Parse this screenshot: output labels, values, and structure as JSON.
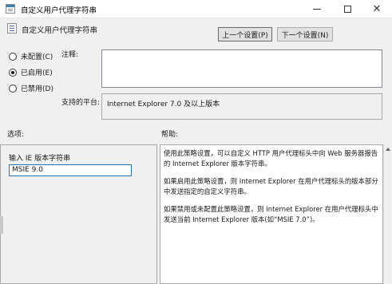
{
  "window": {
    "title": "自定义用户代理字符串",
    "minimize_label": "—",
    "maximize_label": "□",
    "close_label": "✕"
  },
  "header": {
    "setting_name": "自定义用户代理字符串",
    "prev_button": "上一个设置(P)",
    "next_button": "下一个设置(N)"
  },
  "state": {
    "options": [
      {
        "label": "未配置(C)",
        "checked": false
      },
      {
        "label": "已启用(E)",
        "checked": true
      },
      {
        "label": "已禁用(D)",
        "checked": false
      }
    ]
  },
  "comment": {
    "label": "注释:",
    "value": ""
  },
  "support": {
    "label": "支持的平台:",
    "value": "Internet Explorer 7.0 及以上版本"
  },
  "options_section": {
    "heading": "选项:",
    "field_label": "输入 IE 版本字符串",
    "field_value": "MSIE 9.0"
  },
  "help_section": {
    "heading": "帮助:",
    "paragraphs": [
      "使用此策略设置，可以自定义 HTTP 用户代理标头中向 Web 服务器报告的 Internet Explorer 版本字符串。",
      "如果启用此策略设置，则 Internet Explorer 在用户代理标头的版本部分中发送指定的自定义字符串。",
      "如果禁用或未配置此策略设置，则 Internet Explorer 在用户代理标头中发送当前 Internet Explorer 版本(如“MSIE 7.0”)。"
    ]
  },
  "icons": {
    "app": "policy-setting-icon",
    "setting": "policy-setting-icon",
    "scroll_up": "arrow-up-icon"
  }
}
